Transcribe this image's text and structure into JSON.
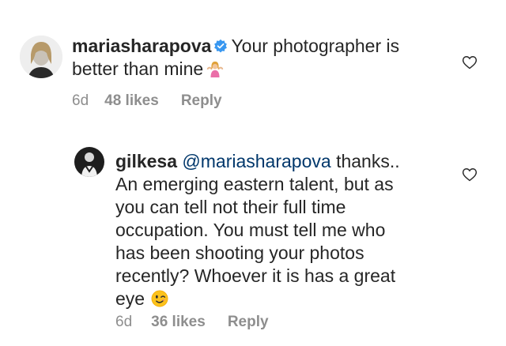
{
  "comments": [
    {
      "username": "mariasharapova",
      "verified": true,
      "text_line1": "Your photographer is",
      "text_line2": "better than mine",
      "emoji": "woman-shrugging-icon",
      "time": "6d",
      "likes": "48 likes",
      "reply": "Reply"
    },
    {
      "username": "gilkesa",
      "mention": "@mariasharapova",
      "text_first": "thanks..",
      "text_lines": [
        "An emerging eastern talent, but as",
        "you can tell not their full time",
        "occupation. You must tell me who",
        "has been shooting your photos",
        "recently? Whoever it is has a great",
        "eye"
      ],
      "emoji": "winking-face-icon",
      "time": "6d",
      "likes": "36 likes",
      "reply": "Reply"
    }
  ],
  "colors": {
    "text": "#262626",
    "meta": "#8e8e8e",
    "mention": "#00376b",
    "verified": "#3897f0"
  }
}
